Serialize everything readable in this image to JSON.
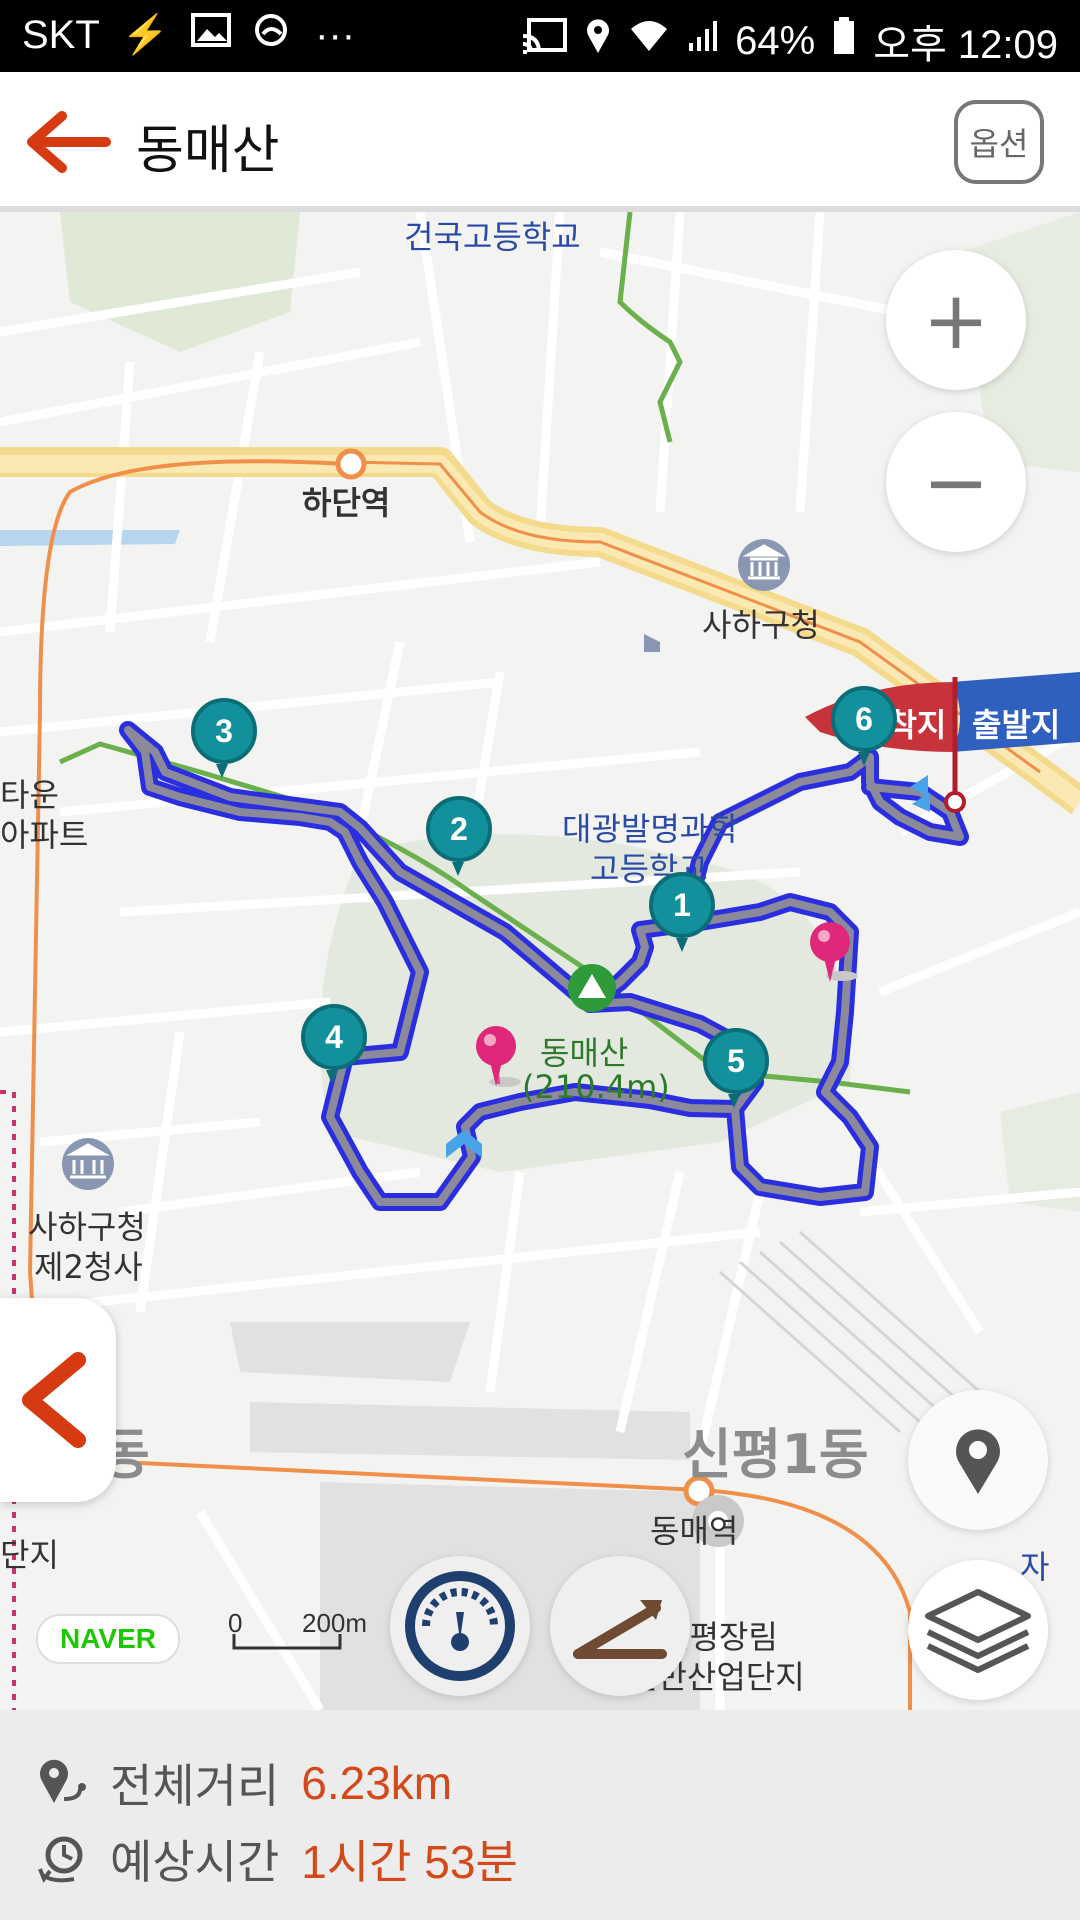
{
  "status_bar": {
    "carrier": "SKT",
    "more": "···",
    "battery": "64%",
    "time": "오후 12:09"
  },
  "header": {
    "title": "동매산",
    "option_label": "옵션"
  },
  "map": {
    "labels": {
      "school_top": "건국고등학교",
      "station_hadan": "하단역",
      "office_saha": "사하구청",
      "school_daegwang_1": "대광발명과학",
      "school_daegwang_2": "고등학교",
      "apt_1": "타운",
      "apt_2": "아파트",
      "office_saha2_1": "사하구청",
      "office_saha2_2": "제2청사",
      "mountain_name": "동매산",
      "mountain_height": "(210.4m)",
      "district_sinpyeong": "신평1동",
      "station_dongmae": "동매역",
      "industrial_1": "신평장림",
      "industrial_2": "일반산업단지",
      "left_frag_1": "동",
      "left_frag_2": "단지",
      "right_frag": "자"
    },
    "flags": {
      "arrival": "도착지",
      "departure": "출발지"
    },
    "waypoints": [
      "1",
      "2",
      "3",
      "4",
      "5",
      "6"
    ],
    "naver_logo": "NAVER",
    "scale": {
      "zero": "0",
      "distance": "200m"
    },
    "buttons": {
      "zoom_in": "+",
      "zoom_out": "−"
    }
  },
  "footer": {
    "distance_label": "전체거리",
    "distance_value": "6.23km",
    "time_label": "예상시간",
    "time_value": "1시간 53분"
  }
}
